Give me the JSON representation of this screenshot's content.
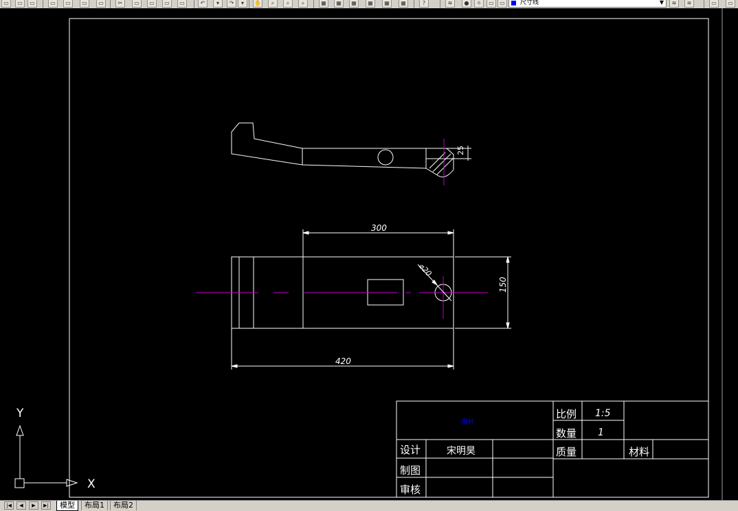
{
  "toolbar": {
    "layer_name": "尺寸线",
    "layer_color": "#0000ff"
  },
  "drawing": {
    "dims": {
      "top_height": "25",
      "length_upper": "300",
      "length_total": "420",
      "hole_dia": "⌀20",
      "width": "150"
    }
  },
  "title_block": {
    "part_name": "撥杆",
    "scale_label": "比例",
    "scale_value": "1:5",
    "qty_label": "数量",
    "qty_value": "1",
    "design_label": "设计",
    "designer": "宋明昊",
    "draw_label": "制图",
    "check_label": "审核",
    "mass_label": "质量",
    "material_label": "材料"
  },
  "ucs": {
    "y": "Y",
    "x": "X"
  },
  "tabs": {
    "model": "模型",
    "layout1": "布局1",
    "layout2": "布局2"
  },
  "colors": {
    "background": "#000000",
    "line": "#ffffff",
    "centerline": "#c000c0",
    "part_name": "#0000ff"
  }
}
